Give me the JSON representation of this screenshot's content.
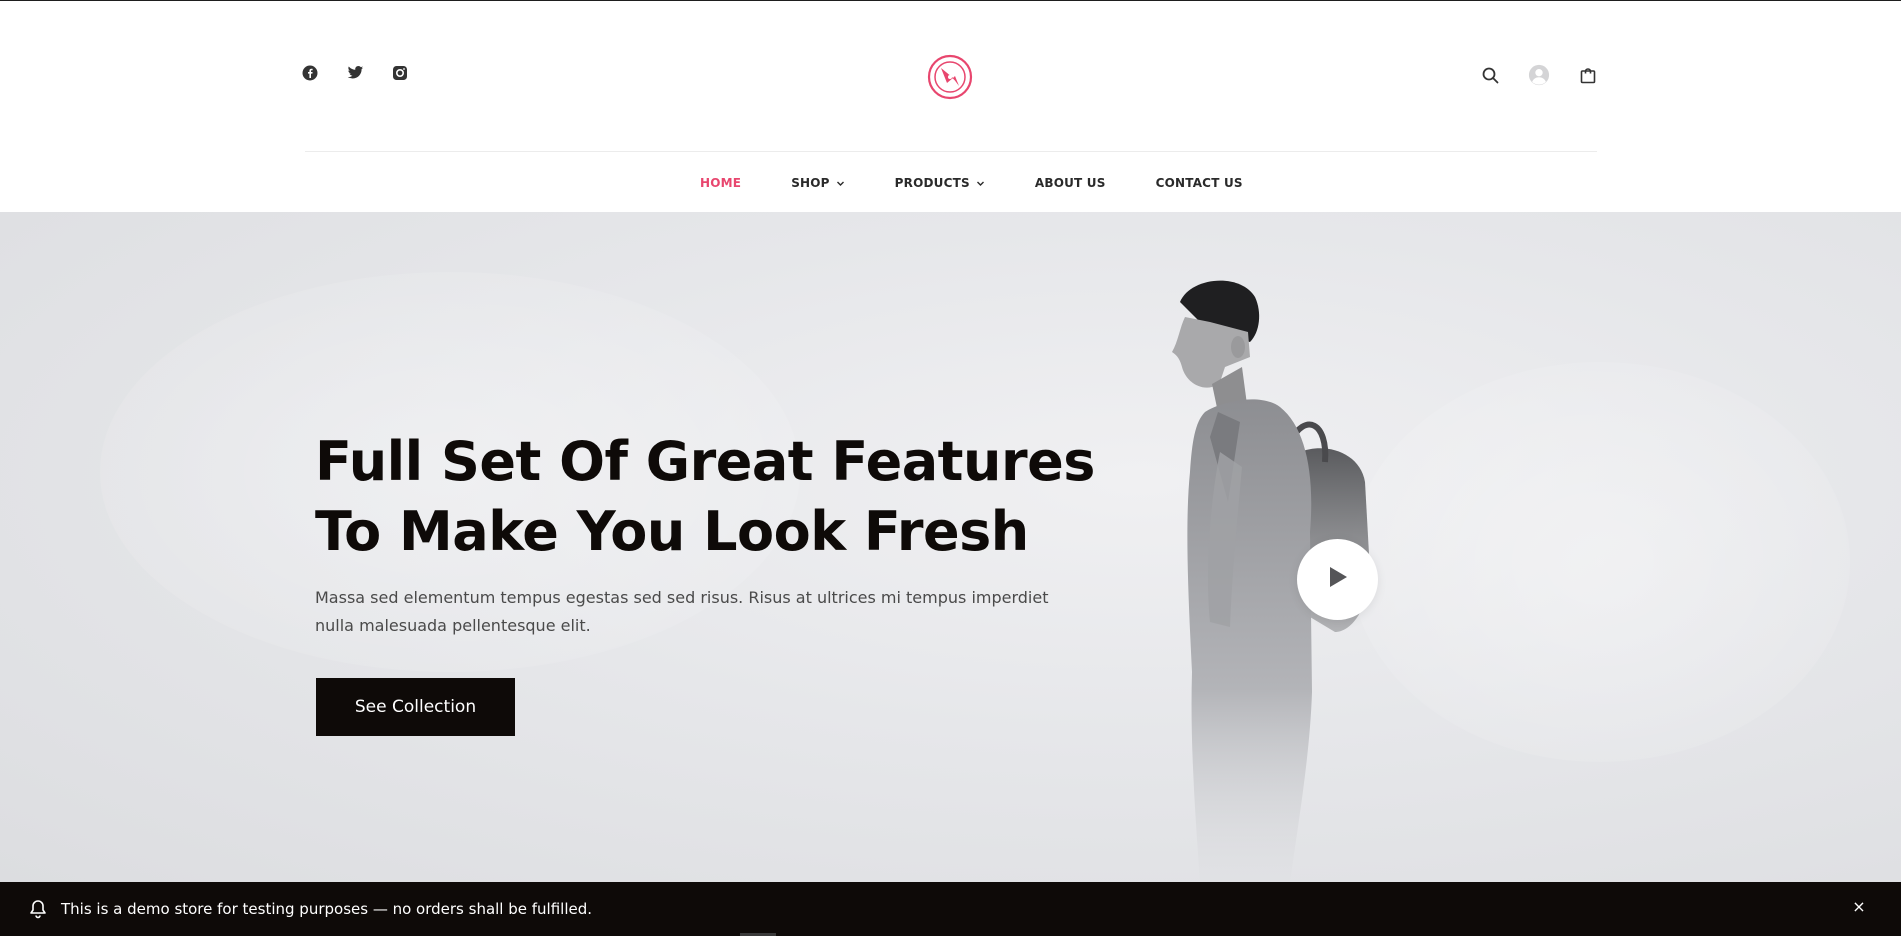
{
  "header": {
    "social": [
      {
        "icon": "facebook-icon"
      },
      {
        "icon": "twitter-icon"
      },
      {
        "icon": "instagram-icon"
      }
    ],
    "logo_icon": "compass-logo-icon",
    "actions": [
      {
        "icon": "search-icon"
      },
      {
        "icon": "user-avatar-icon"
      },
      {
        "icon": "shopping-bag-icon"
      }
    ],
    "brand_color": "#e8466e"
  },
  "nav": {
    "items": [
      {
        "label": "HOME",
        "active": true,
        "dropdown": false
      },
      {
        "label": "SHOP",
        "active": false,
        "dropdown": true
      },
      {
        "label": "PRODUCTS",
        "active": false,
        "dropdown": true
      },
      {
        "label": "ABOUT US",
        "active": false,
        "dropdown": false
      },
      {
        "label": "CONTACT US",
        "active": false,
        "dropdown": false
      }
    ]
  },
  "hero": {
    "title_line1": "Full Set Of Great Features",
    "title_line2": "To Make You Look Fresh",
    "subtitle_line1": "Massa sed elementum tempus egestas sed sed risus. Risus at ultrices mi tempus imperdiet",
    "subtitle_line2": "nulla malesuada pellentesque elit.",
    "button_label": "See Collection",
    "play_icon": "play-icon"
  },
  "demo_notice": {
    "icon": "bell-icon",
    "text": "This is a demo store for testing purposes — no orders shall be fulfilled.",
    "close_label": "×"
  }
}
